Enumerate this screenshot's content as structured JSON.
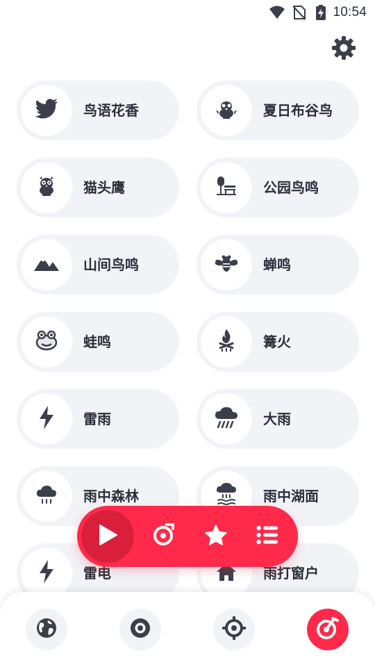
{
  "status_bar": {
    "time": "10:54",
    "icons": [
      "wifi-icon",
      "no-sim-icon",
      "battery-charging-icon"
    ]
  },
  "header": {
    "settings_icon": "gear-icon"
  },
  "sounds": [
    {
      "label": "鸟语花香",
      "icon": "twitter-bird-icon"
    },
    {
      "label": "夏日布谷鸟",
      "icon": "cuckoo-bird-icon"
    },
    {
      "label": "猫头鹰",
      "icon": "owl-icon"
    },
    {
      "label": "公园鸟鸣",
      "icon": "park-bench-icon"
    },
    {
      "label": "山间鸟鸣",
      "icon": "mountain-icon"
    },
    {
      "label": "蝉鸣",
      "icon": "cicada-icon"
    },
    {
      "label": "蛙鸣",
      "icon": "frog-icon"
    },
    {
      "label": "篝火",
      "icon": "campfire-icon"
    },
    {
      "label": "雷雨",
      "icon": "lightning-icon"
    },
    {
      "label": "大雨",
      "icon": "heavy-rain-icon"
    },
    {
      "label": "雨中森林",
      "icon": "rain-cloud-icon"
    },
    {
      "label": "雨中湖面",
      "icon": "rain-lake-icon"
    },
    {
      "label": "雷电",
      "icon": "lightning-icon"
    },
    {
      "label": "雨打窗户",
      "icon": "house-icon"
    }
  ],
  "player": {
    "buttons": [
      "play-icon",
      "timer-icon",
      "star-icon",
      "list-icon"
    ]
  },
  "bottom_nav": {
    "items": [
      "globe-icon",
      "disc-icon",
      "target-icon",
      "music-note-icon"
    ],
    "active_index": 3
  },
  "colors": {
    "accent": "#ff2a4a",
    "accent_dark": "#d91f3c",
    "card_bg": "#f1f3f7",
    "text": "#2b2f3a"
  }
}
